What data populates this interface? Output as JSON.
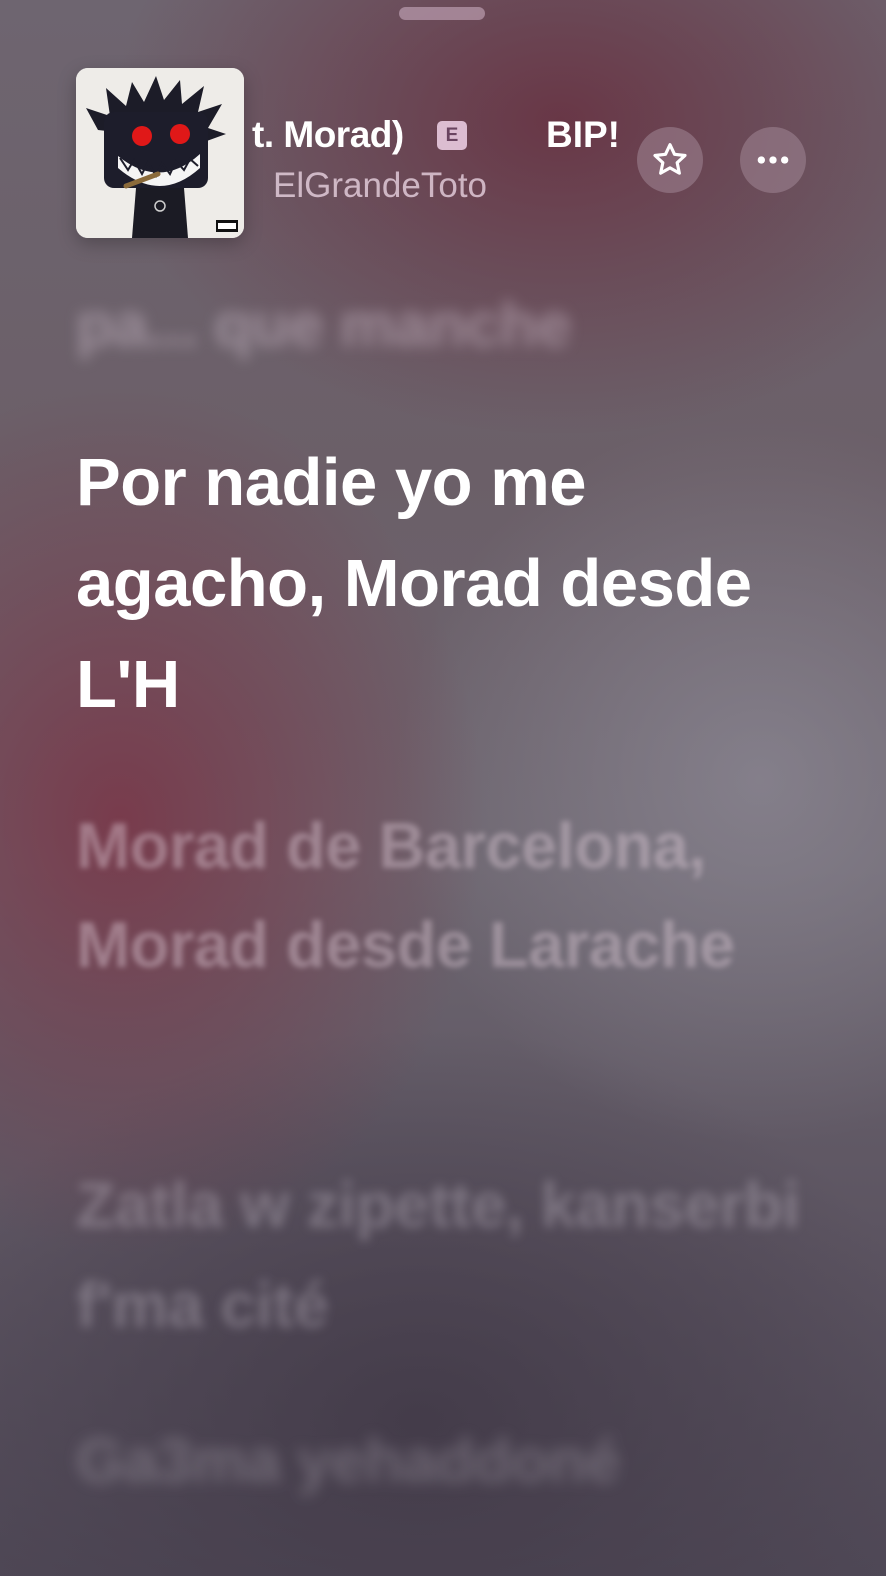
{
  "now_playing": {
    "title_visible_fragment": "t. Morad)",
    "explicit_badge": "E",
    "title_scroll_fragment": "BIP!",
    "artist": "ElGrandeToto",
    "artwork_icon": "album-artwork",
    "favorite_icon": "star-icon",
    "more_icon": "ellipsis-icon"
  },
  "lyrics": {
    "previous_line": "pa... que manche",
    "current_line": "Por nadie yo me agacho, Morad desde L'H",
    "next_lines": [
      "Morad de Barcelona, Morad desde Larache",
      "Zatla w zipette, kanserbi f'ma cité",
      "Ga3ma yehaddoné"
    ]
  },
  "colors": {
    "current_lyric": "#ffffff",
    "background_primary": "#6a636b",
    "background_accent": "#7a3446"
  }
}
